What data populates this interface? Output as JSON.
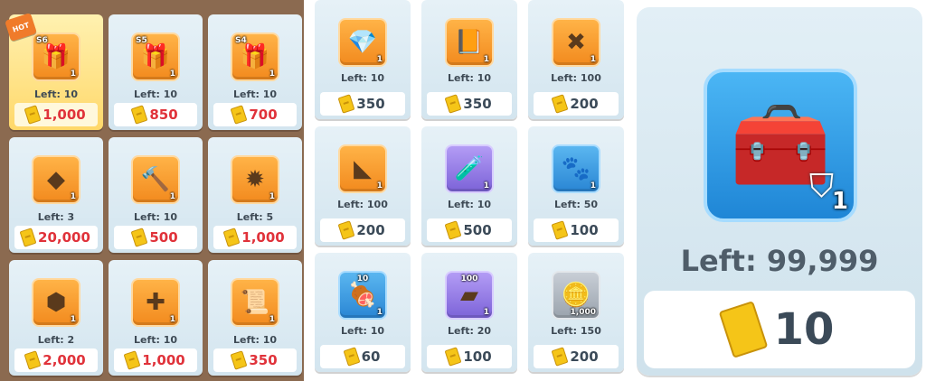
{
  "left_panel": {
    "hot_badge": "HOT",
    "items": [
      {
        "tag": "S6",
        "left": "Left: 10",
        "price": "1,000",
        "qty": "1",
        "icon": "gift-chest-icon",
        "glyph": "🎁",
        "box": "",
        "hot": true
      },
      {
        "tag": "S5",
        "left": "Left: 10",
        "price": "850",
        "qty": "1",
        "icon": "gift-chest-icon",
        "glyph": "🎁",
        "box": ""
      },
      {
        "tag": "S4",
        "left": "Left: 10",
        "price": "700",
        "qty": "1",
        "icon": "gift-chest-icon",
        "glyph": "🎁",
        "box": ""
      },
      {
        "tag": "",
        "left": "Left: 3",
        "price": "20,000",
        "qty": "1",
        "icon": "crystal-ore-icon",
        "glyph": "◆",
        "box": ""
      },
      {
        "tag": "",
        "left": "Left: 10",
        "price": "500",
        "qty": "1",
        "icon": "hammer-icon",
        "glyph": "🔨",
        "box": ""
      },
      {
        "tag": "",
        "left": "Left: 5",
        "price": "1,000",
        "qty": "1",
        "icon": "emblem-icon",
        "glyph": "✹",
        "box": ""
      },
      {
        "tag": "",
        "left": "Left: 2",
        "price": "2,000",
        "qty": "1",
        "icon": "dark-stone-icon",
        "glyph": "⬢",
        "box": ""
      },
      {
        "tag": "",
        "left": "Left: 10",
        "price": "1,000",
        "qty": "1",
        "icon": "puzzle-piece-icon",
        "glyph": "✚",
        "box": ""
      },
      {
        "tag": "",
        "left": "Left: 10",
        "price": "350",
        "qty": "1",
        "icon": "blueprint-scroll-icon",
        "glyph": "📜",
        "box": ""
      }
    ]
  },
  "mid_panel": {
    "items": [
      {
        "tag": "",
        "left": "Left: 10",
        "price": "350",
        "qty": "1",
        "icon": "diamond-scroll-icon",
        "glyph": "💎",
        "box": ""
      },
      {
        "tag": "",
        "left": "Left: 10",
        "price": "350",
        "qty": "1",
        "icon": "diamond-book-icon",
        "glyph": "📙",
        "box": ""
      },
      {
        "tag": "",
        "left": "Left: 100",
        "price": "200",
        "qty": "1",
        "icon": "map-scroll-icon",
        "glyph": "✖",
        "box": ""
      },
      {
        "tag": "",
        "left": "Left: 100",
        "price": "200",
        "qty": "1",
        "icon": "fragment-icon",
        "glyph": "◣",
        "box": ""
      },
      {
        "tag": "",
        "left": "Left: 10",
        "price": "500",
        "qty": "1",
        "icon": "potion-icon",
        "glyph": "🧪",
        "box": "purple"
      },
      {
        "tag": "",
        "left": "Left: 50",
        "price": "100",
        "qty": "1",
        "icon": "paw-book-icon",
        "glyph": "🐾",
        "box": "blue"
      },
      {
        "tag": "10",
        "left": "Left: 10",
        "price": "60",
        "qty": "1",
        "icon": "meat-icon",
        "glyph": "🍖",
        "box": "blue"
      },
      {
        "tag": "100",
        "left": "Left: 20",
        "price": "100",
        "qty": "1",
        "icon": "parchment-icon",
        "glyph": "▰",
        "box": "purple"
      },
      {
        "tag": "",
        "left": "Left: 150",
        "price": "200",
        "qty": "1,000",
        "icon": "gold-coin-icon",
        "glyph": "🪙",
        "box": "grey"
      }
    ]
  },
  "right_panel": {
    "left": "Left: 99,999",
    "price": "10",
    "qty": "1",
    "icon": "treasure-chest-icon",
    "glyph": "🧰"
  }
}
